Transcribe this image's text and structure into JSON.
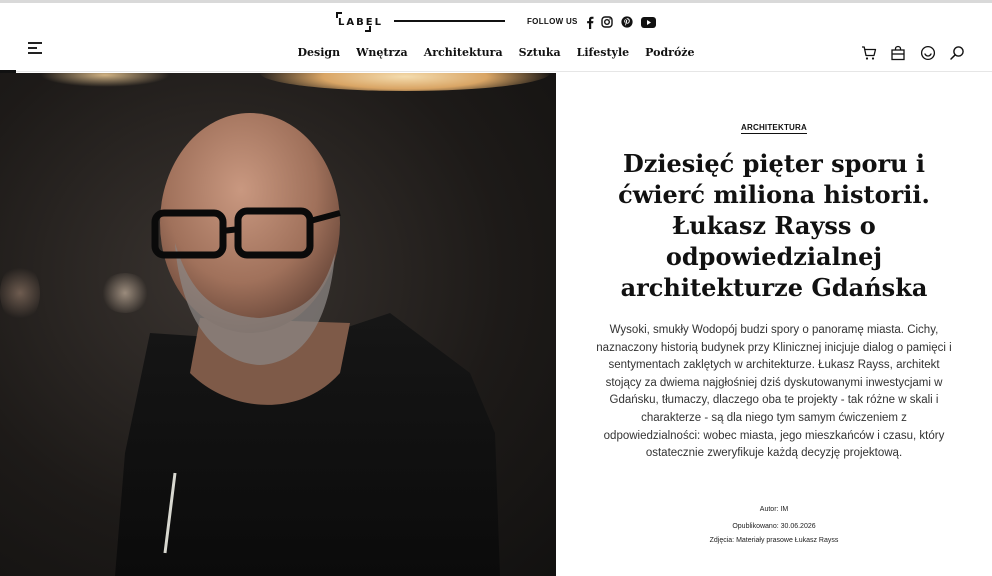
{
  "brand": {
    "logo_text": "LABEL"
  },
  "header": {
    "follow_label": "FOLLOW US",
    "social": [
      "facebook-icon",
      "instagram-icon",
      "pinterest-icon",
      "youtube-icon"
    ],
    "nav": [
      "Design",
      "Wnętrza",
      "Architektura",
      "Sztuka",
      "Lifestyle",
      "Podróże"
    ],
    "icons": [
      "cart-icon",
      "bag-icon",
      "smile-icon",
      "search-icon"
    ]
  },
  "article": {
    "category": "ARCHITEKTURA",
    "title": "Dziesięć pięter sporu i ćwierć miliona historii. Łukasz Rayss o odpowiedzialnej architekturze Gdańska",
    "lead": "Wysoki, smukły Wodopój budzi spory o panoramę miasta. Cichy, naznaczony historią budynek przy Klinicznej inicjuje dialog o pamięci i sentymentach zaklętych w architekturze. Łukasz Rayss, architekt stojący za dwiema najgłośniej dziś dyskutowanymi inwestycjami w Gdańsku, tłumaczy, dlaczego oba te projekty - tak różne w skali i charakterze - są dla niego tym samym ćwiczeniem z odpowiedzialności: wobec miasta, jego mieszkańców i czasu, który ostatecznie zweryfikuje każdą decyzję projektową.",
    "author": "Autor: IM",
    "published": "Opublikowano: 30.06.2026",
    "photos": "Zdjęcia: Materiały prasowe Łukasz Rayss"
  },
  "colors": {
    "text": "#111111",
    "muted": "#333333",
    "hero_dark": "#1d1a18"
  }
}
